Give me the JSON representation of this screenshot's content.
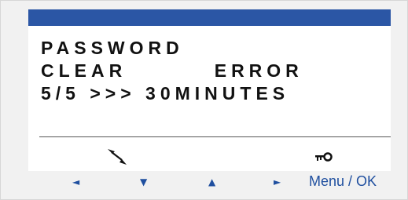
{
  "display": {
    "lines": [
      "PASSWORD",
      "CLEAR         ERROR",
      "5/5 >>> 30MINUTES"
    ],
    "icons": {
      "left": "navigate-arrows-icon",
      "right": "key-icon"
    }
  },
  "keypad": {
    "left_arrow": "◄",
    "down_arrow": "▼",
    "up_arrow": "▲",
    "right_arrow": "►",
    "menu_ok_label": "Menu / OK"
  },
  "colors": {
    "title_bar": "#2b56a5",
    "accent_text": "#1f4f9f"
  }
}
